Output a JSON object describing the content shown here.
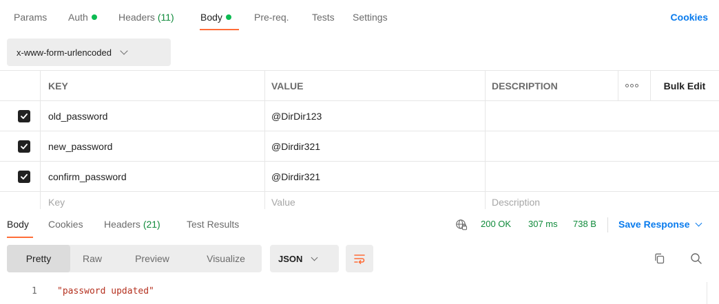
{
  "request_tabs": {
    "params": "Params",
    "auth": "Auth",
    "headers": "Headers",
    "headers_count": "(11)",
    "body": "Body",
    "prereq": "Pre-req.",
    "tests": "Tests",
    "settings": "Settings",
    "cookies": "Cookies"
  },
  "body_type": "x-www-form-urlencoded",
  "table": {
    "headers": {
      "key": "KEY",
      "value": "VALUE",
      "description": "DESCRIPTION",
      "bulk_edit": "Bulk Edit"
    },
    "rows": [
      {
        "checked": true,
        "key": "old_password",
        "value": "@DirDir123",
        "description": ""
      },
      {
        "checked": true,
        "key": "new_password",
        "value": "@Dirdir321",
        "description": ""
      },
      {
        "checked": true,
        "key": "confirm_password",
        "value": "@Dirdir321",
        "description": ""
      }
    ],
    "placeholders": {
      "key": "Key",
      "value": "Value",
      "description": "Description"
    }
  },
  "response_tabs": {
    "body": "Body",
    "cookies": "Cookies",
    "headers": "Headers",
    "headers_count": "(21)",
    "test_results": "Test Results"
  },
  "response_status": {
    "status": "200 OK",
    "time": "307 ms",
    "size": "738 B",
    "save": "Save Response"
  },
  "view_modes": [
    "Pretty",
    "Raw",
    "Preview",
    "Visualize"
  ],
  "active_view": "Pretty",
  "format": "JSON",
  "code_lines": [
    {
      "number": "1",
      "text": "\"password updated\""
    }
  ],
  "colors": {
    "accent": "#ff6c37",
    "link": "#097bed",
    "success": "#0cbb52",
    "string": "#b5311f"
  }
}
